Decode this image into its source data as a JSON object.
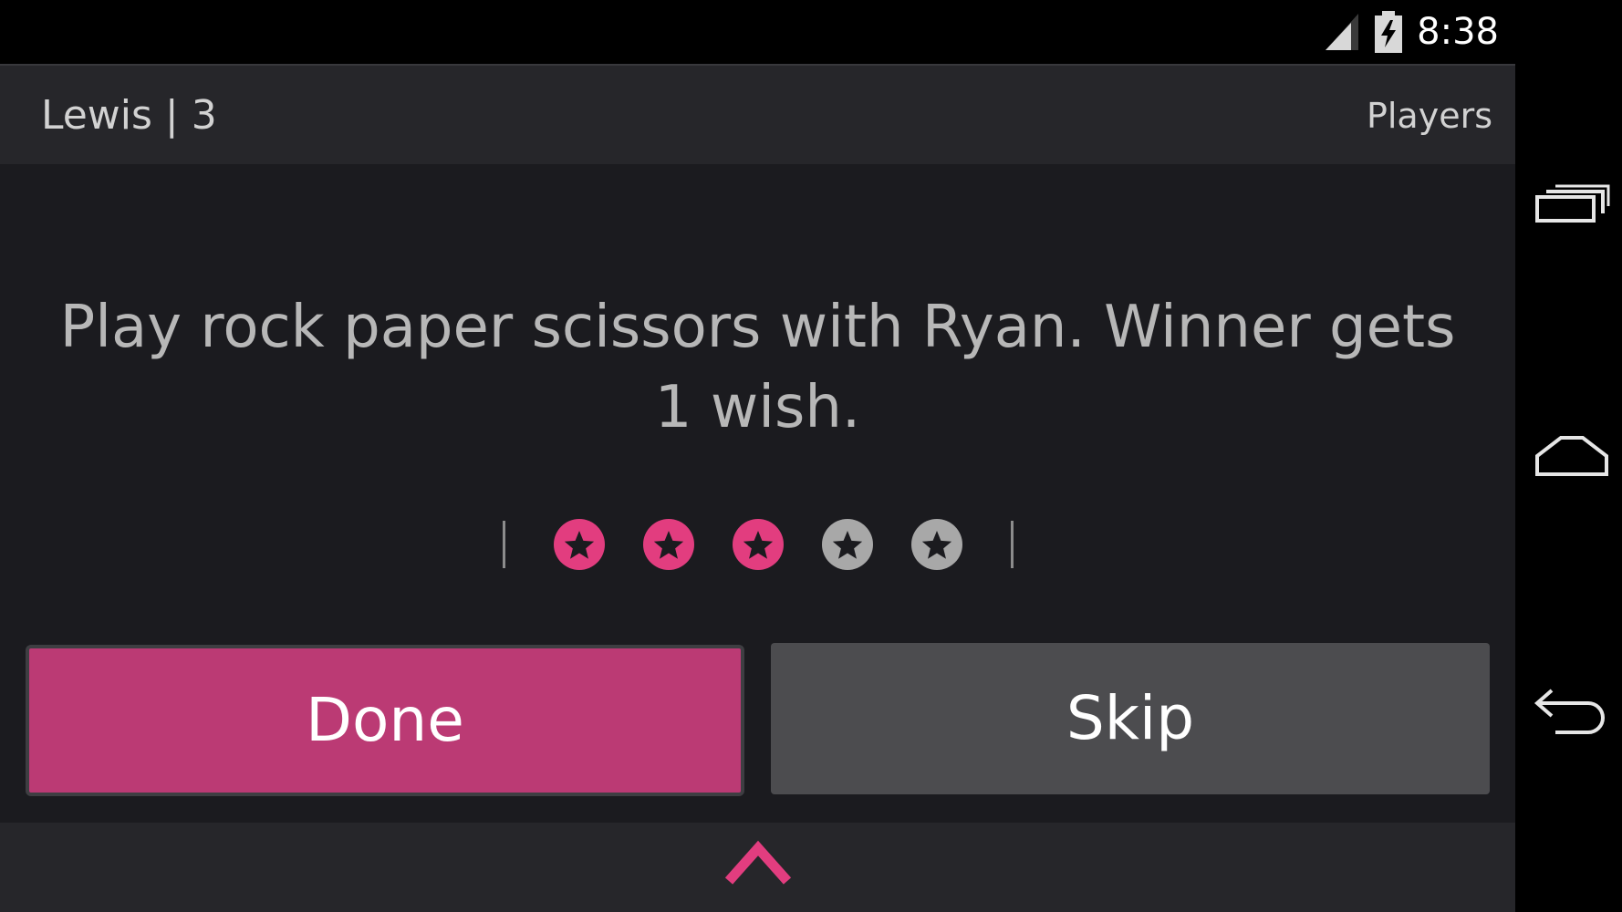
{
  "status_bar": {
    "time": "8:38",
    "icons": [
      "signal-icon",
      "battery-charging-icon"
    ]
  },
  "action_bar": {
    "title": "Lewis | 3",
    "players_label": "Players"
  },
  "task": {
    "text": "Play rock paper scissors with Ryan. Winner gets 1 wish."
  },
  "rating": {
    "value": 3,
    "max": 5
  },
  "buttons": {
    "done_label": "Done",
    "skip_label": "Skip"
  },
  "bottom_bar": {
    "icon": "chevron-up-icon"
  },
  "nav_bar": {
    "icons": [
      "recent-apps-icon",
      "home-icon",
      "back-icon"
    ]
  },
  "colors": {
    "accent": "#bb3a74",
    "star_active": "#e23d7f",
    "star_inactive": "#a8a8a8",
    "background": "#1b1b1f",
    "bar": "#26262a",
    "skip": "#4c4c4f"
  }
}
